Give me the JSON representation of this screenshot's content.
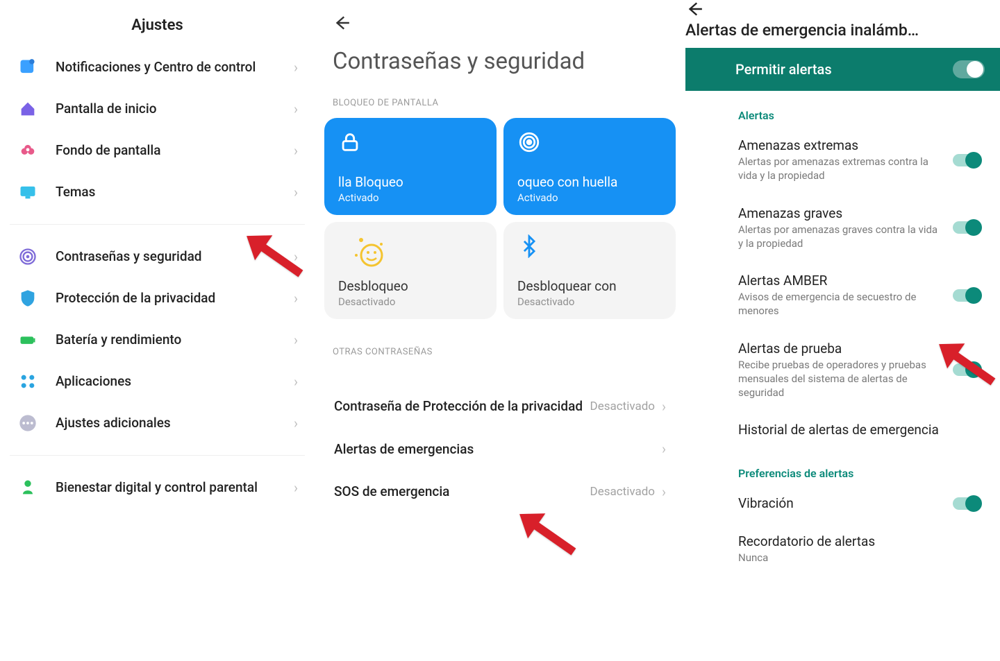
{
  "panel1": {
    "title": "Ajustes",
    "items_a": [
      {
        "label": "Notificaciones y Centro de control",
        "icon": "notifications",
        "color": "#3aa0ff"
      },
      {
        "label": "Pantalla de inicio",
        "icon": "home",
        "color": "#7a62e6"
      },
      {
        "label": "Fondo de pantalla",
        "icon": "flower",
        "color": "#e85a8a"
      },
      {
        "label": "Temas",
        "icon": "themes",
        "color": "#36c0ea"
      }
    ],
    "items_b": [
      {
        "label": "Contraseñas y seguridad",
        "icon": "fingerprint",
        "color": "#7e6bd8"
      },
      {
        "label": "Protección de la privacidad",
        "icon": "shield",
        "color": "#2fa3e0"
      },
      {
        "label": "Batería y rendimiento",
        "icon": "battery",
        "color": "#2cc05c"
      },
      {
        "label": "Aplicaciones",
        "icon": "apps",
        "color": "#2aa4e0"
      },
      {
        "label": "Ajustes adicionales",
        "icon": "dots",
        "color": "#bcbcd0"
      }
    ],
    "items_c": [
      {
        "label": "Bienestar digital y control parental",
        "icon": "wellbeing",
        "color": "#2cc05c"
      }
    ]
  },
  "panel2": {
    "title": "Contraseñas y seguridad",
    "section1": "BLOQUEO DE PANTALLA",
    "tiles": [
      {
        "label": "lla        Bloqueo",
        "status": "Activado",
        "type": "blue",
        "icon": "lock"
      },
      {
        "label": "oqueo con huella",
        "status": "Activado",
        "type": "blue",
        "icon": "fingerprint2"
      },
      {
        "label": "Desbloqueo",
        "status": "Desactivado",
        "type": "grey",
        "icon": "smiley"
      },
      {
        "label": "Desbloquear con",
        "status": "Desactivado",
        "type": "grey",
        "icon": "bluetooth"
      }
    ],
    "section2": "OTRAS CONTRASEÑAS",
    "list": [
      {
        "label": "Contraseña de Protección de la privacidad",
        "status": "Desactivado"
      },
      {
        "label": "Alertas de emergencias",
        "status": ""
      },
      {
        "label": "SOS de emergencia",
        "status": "Desactivado"
      }
    ]
  },
  "panel3": {
    "title": "Alertas de emergencia inalámb…",
    "banner": "Permitir alertas",
    "section1": "Alertas",
    "items": [
      {
        "title": "Amenazas extremas",
        "sub": "Alertas por amenazas extremas contra la vida y la propiedad",
        "toggle": true
      },
      {
        "title": "Amenazas graves",
        "sub": "Alertas por amenazas graves contra la vida y la propiedad",
        "toggle": true
      },
      {
        "title": "Alertas AMBER",
        "sub": "Avisos de emergencia de secuestro de menores",
        "toggle": true
      },
      {
        "title": "Alertas de prueba",
        "sub": "Recibe pruebas de operadores y pruebas mensuales del sistema de alertas de seguridad",
        "toggle": true
      },
      {
        "title": "Historial de alertas de emergencia",
        "sub": "",
        "toggle": false
      }
    ],
    "section2": "Preferencias de alertas",
    "items2": [
      {
        "title": "Vibración",
        "sub": "",
        "toggle": true
      },
      {
        "title": "Recordatorio de alertas",
        "sub": "Nunca",
        "toggle": false
      }
    ]
  }
}
